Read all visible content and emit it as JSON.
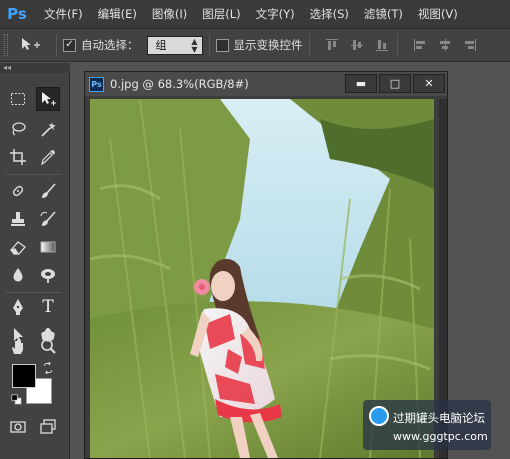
{
  "app": {
    "logo_text": "Ps"
  },
  "menu": [
    {
      "label": "文件(F)"
    },
    {
      "label": "编辑(E)"
    },
    {
      "label": "图像(I)"
    },
    {
      "label": "图层(L)"
    },
    {
      "label": "文字(Y)"
    },
    {
      "label": "选择(S)"
    },
    {
      "label": "滤镜(T)"
    },
    {
      "label": "视图(V)"
    }
  ],
  "options": {
    "auto_select_label": "自动选择：",
    "auto_select_checked": true,
    "auto_select_target": "组",
    "show_transform_label": "显示变换控件",
    "show_transform_checked": false
  },
  "toolbox": {
    "collapse_glyph": "◂◂",
    "tools": [
      {
        "name": "marquee-tool-icon"
      },
      {
        "name": "move-tool-icon",
        "active": true
      },
      {
        "name": "lasso-tool-icon"
      },
      {
        "name": "magic-wand-tool-icon"
      },
      {
        "name": "crop-tool-icon"
      },
      {
        "name": "eyedropper-tool-icon"
      },
      {
        "name": "spot-healing-tool-icon"
      },
      {
        "name": "brush-tool-icon"
      },
      {
        "name": "clone-stamp-tool-icon"
      },
      {
        "name": "history-brush-tool-icon"
      },
      {
        "name": "eraser-tool-icon"
      },
      {
        "name": "gradient-tool-icon"
      },
      {
        "name": "blur-tool-icon"
      },
      {
        "name": "dodge-tool-icon"
      },
      {
        "name": "pen-tool-icon"
      },
      {
        "name": "type-tool-icon"
      },
      {
        "name": "path-selection-tool-icon"
      },
      {
        "name": "custom-shape-tool-icon"
      },
      {
        "name": "hand-tool-icon"
      },
      {
        "name": "zoom-tool-icon"
      }
    ],
    "type_tool_glyph": "T",
    "foreground_color": "#000000",
    "background_color": "#ffffff"
  },
  "document": {
    "title": "0.jpg @ 68.3%(RGB/8#)",
    "ps_badge": "Ps",
    "minimize_glyph": "▬",
    "maximize_glyph": "□",
    "close_glyph": "✕"
  },
  "watermark": {
    "title": "过期罐头电脑论坛",
    "url": "www.gggtpc.com"
  },
  "colors": {
    "accent": "#3fa3ff",
    "panel": "#424242",
    "menubar": "#3a3a3a"
  }
}
